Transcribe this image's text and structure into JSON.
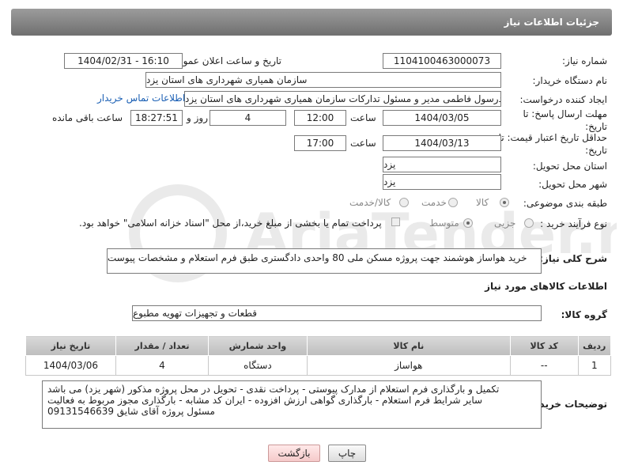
{
  "header": {
    "title": "جزئیات اطلاعات نیاز"
  },
  "form": {
    "need_number_label": "شماره نیاز:",
    "need_number": "1104100463000073",
    "announce_label": "تاریخ و ساعت اعلان عمومی:",
    "announce_value": "1404/02/31 - 16:10",
    "buyer_org_label": "نام دستگاه خریدار:",
    "buyer_org": "سازمان همیاری شهرداری های استان یزد",
    "requester_label": "ایجاد کننده درخواست:",
    "requester": "سیدرسول فاطمی مدیر و مسئول تدارکات سازمان همیاری شهرداری های استان یزد",
    "buyer_contact_link": "اطلاعات تماس خریدار",
    "reply_deadline_label": "مهلت ارسال پاسخ: تا تاریخ:",
    "reply_date": "1404/03/05",
    "time_label": "ساعت",
    "reply_time": "12:00",
    "days_value": "4",
    "days_label": "روز و",
    "remaining_time": "18:27:51",
    "remaining_label": "ساعت باقی مانده",
    "price_validity_label": "حداقل تاریخ اعتبار قیمت: تا تاریخ:",
    "price_date": "1404/03/13",
    "price_time": "17:00",
    "province_label": "استان محل تحویل:",
    "province": "یزد",
    "city_label": "شهر محل تحویل:",
    "city": "یزد",
    "category_label": "طبقه بندی موضوعی:",
    "category_options": [
      "کالا",
      "خدمت",
      "کالا/خدمت"
    ],
    "process_label": "نوع فرآیند خرید :",
    "process_options": [
      "جزیی",
      "متوسط"
    ],
    "payment_note": "پرداخت تمام یا بخشی از مبلغ خرید،از محل \"اسناد خزانه اسلامی\" خواهد بود.",
    "description_label": "شرح کلی نیاز:",
    "description": "خرید هواساز هوشمند جهت پروژه مسکن ملی 80 واحدی دادگستری طبق فرم استعلام و مشخصات پیوست"
  },
  "goods": {
    "section_title": "اطلاعات کالاهای مورد نیاز",
    "group_label": "گروه کالا:",
    "group_value": "قطعات و تجهیزات تهویه مطبوع",
    "columns": [
      "ردیف",
      "کد کالا",
      "نام کالا",
      "واحد شمارش",
      "تعداد / مقدار",
      "تاریخ نیاز"
    ],
    "rows": [
      [
        "1",
        "--",
        "هواساز",
        "دستگاه",
        "4",
        "1404/03/06"
      ]
    ]
  },
  "buyer_notes": {
    "label": "توضیحات خریدار:",
    "lines": [
      "تکمیل و بارگذاری فرم استعلام از مدارک پیوستی - پرداخت نقدی - تحویل در محل پروژه مذکور (شهر یزد) می باشد",
      "سایر شرایط فرم استعلام - بارگذاری گواهی ارزش افزوده - ایران کد مشابه - بارگذاری مجوز مربوط به فعالیت",
      "مسئول پروژه آقای شایق 09131546639"
    ]
  },
  "buttons": {
    "print": "چاپ",
    "back": "بازگشت"
  },
  "watermark": {
    "text": "AriaTender.net"
  }
}
